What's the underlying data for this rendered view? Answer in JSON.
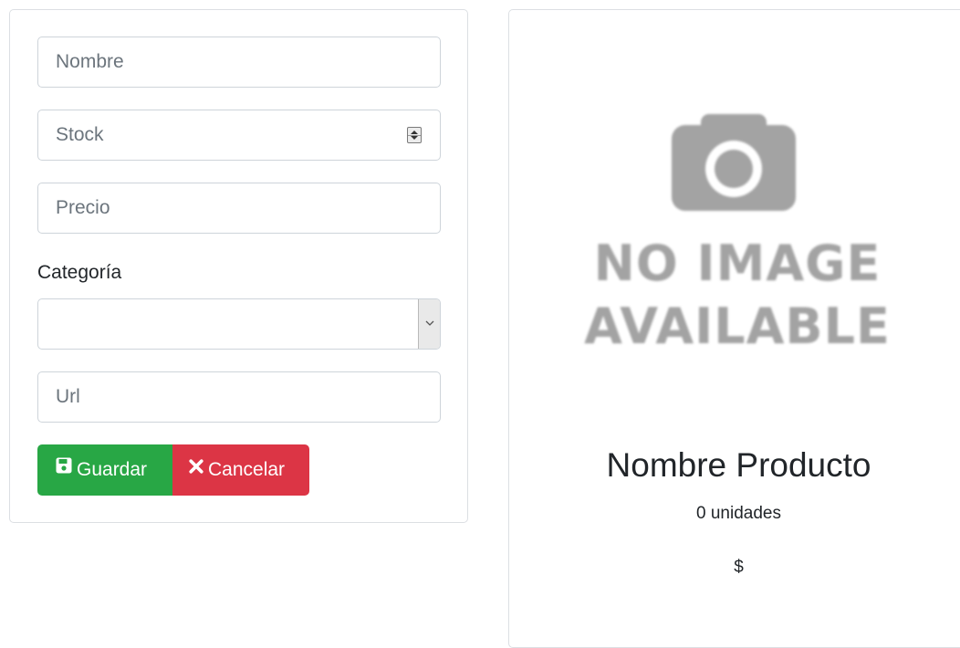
{
  "form": {
    "nombre_placeholder": "Nombre",
    "nombre_value": "",
    "stock_placeholder": "Stock",
    "stock_value": "",
    "precio_placeholder": "Precio",
    "precio_value": "",
    "categoria_label": "Categoría",
    "categoria_selected": "",
    "url_placeholder": "Url",
    "url_value": ""
  },
  "buttons": {
    "save_label": "Guardar",
    "save_icon": "floppy-disk-icon",
    "cancel_label": "Cancelar",
    "cancel_icon": "times-icon"
  },
  "preview": {
    "image_text_line1": "NO IMAGE",
    "image_text_line2": "AVAILABLE",
    "image_icon": "camera-icon",
    "name": "Nombre Producto",
    "units": "0 unidades",
    "price": "$"
  },
  "colors": {
    "save": "#28a745",
    "cancel": "#dc3545",
    "placeholder": "#6c757d",
    "noimage_gray": "#a3a3a3"
  }
}
